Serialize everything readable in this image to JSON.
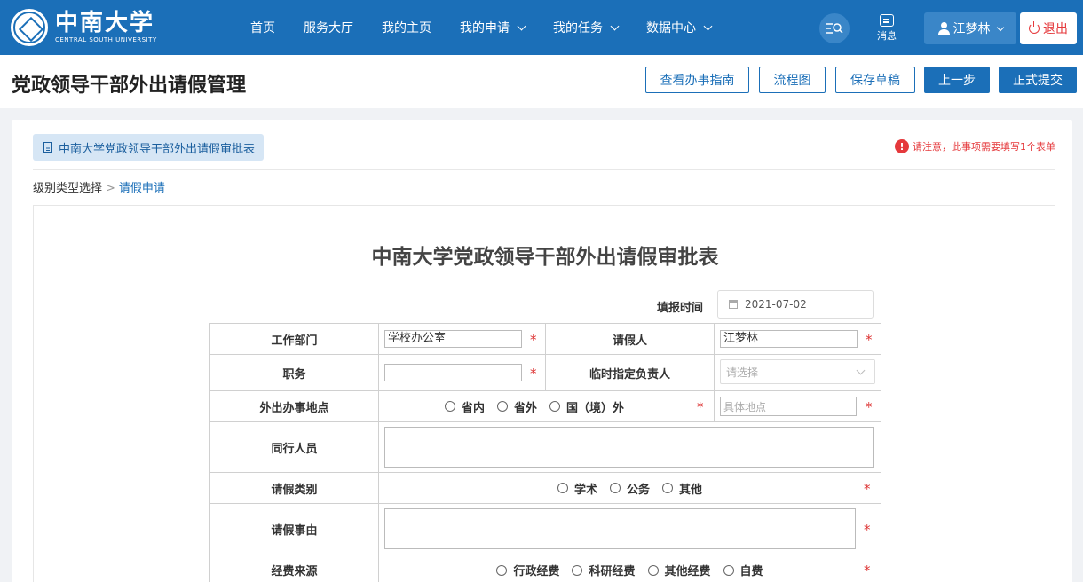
{
  "header": {
    "logo_cn": "中南大学",
    "logo_en": "CENTRAL SOUTH UNIVERSITY",
    "nav": [
      {
        "label": "首页",
        "dropdown": false
      },
      {
        "label": "服务大厅",
        "dropdown": false
      },
      {
        "label": "我的主页",
        "dropdown": false
      },
      {
        "label": "我的申请",
        "dropdown": true
      },
      {
        "label": "我的任务",
        "dropdown": true
      },
      {
        "label": "数据中心",
        "dropdown": true
      }
    ],
    "message_label": "消息",
    "user_name": "江梦林",
    "logout_label": "退出",
    "brand_color": "#1b6fb8"
  },
  "titlebar": {
    "title": "党政领导干部外出请假管理",
    "buttons": {
      "guide": "查看办事指南",
      "flowchart": "流程图",
      "save_draft": "保存草稿",
      "prev_step": "上一步",
      "submit": "正式提交"
    }
  },
  "content": {
    "form_tag": "中南大学党政领导干部外出请假审批表",
    "notice": "请注意，此事项需要填写1个表单",
    "breadcrumb": {
      "step1": "级别类型选择",
      "sep": ">",
      "step2": "请假申请"
    }
  },
  "form": {
    "title": "中南大学党政领导干部外出请假审批表",
    "fill_time_label": "填报时间",
    "fill_time_value": "2021-07-02",
    "labels": {
      "department": "工作部门",
      "applicant": "请假人",
      "position": "职务",
      "deputy": "临时指定负责人",
      "location": "外出办事地点",
      "companions": "同行人员",
      "leave_type": "请假类别",
      "reason": "请假事由",
      "funding": "经费来源"
    },
    "values": {
      "department": "学校办公室",
      "applicant": "江梦林",
      "position": ""
    },
    "deputy_placeholder": "请选择",
    "location_options": [
      "省内",
      "省外",
      "国（境）外"
    ],
    "address_placeholder": "具体地点",
    "leave_type_options": [
      "学术",
      "公务",
      "其他"
    ],
    "funding_options": [
      "行政经费",
      "科研经费",
      "其他经费",
      "自费"
    ],
    "required_mark": "*"
  }
}
